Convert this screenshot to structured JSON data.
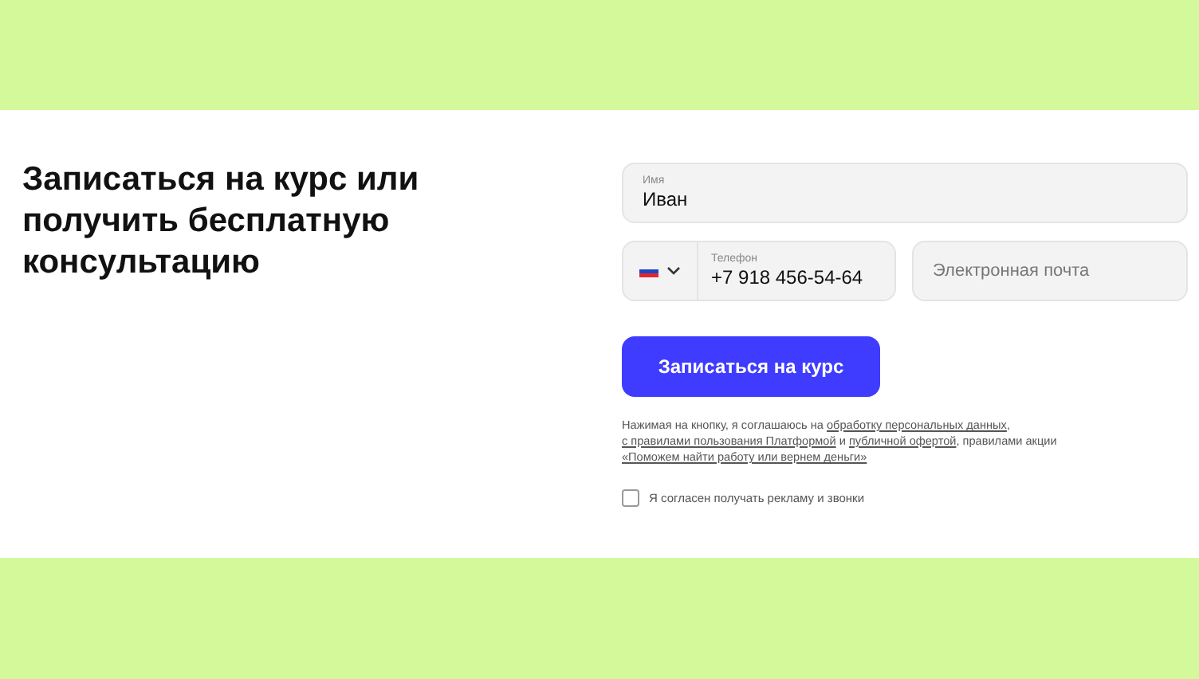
{
  "heading": "Записаться на курс или получить бесплатную консультацию",
  "name_field": {
    "label": "Имя",
    "value": "Иван"
  },
  "phone_field": {
    "label": "Телефон",
    "value": "+7 918 456-54-64"
  },
  "email_field": {
    "placeholder": "Электронная почта"
  },
  "submit_button": "Записаться на курс",
  "consent_text": [
    {
      "kind": "text",
      "text": "Нажимая на кнопку, я соглашаюсь на "
    },
    {
      "kind": "link",
      "text": "обработку персональных данных"
    },
    {
      "kind": "text",
      "text": ",  "
    },
    {
      "kind": "link",
      "text": "с правилами пользования Платформой"
    },
    {
      "kind": "text",
      "text": " и "
    },
    {
      "kind": "link",
      "text": "публичной офертой"
    },
    {
      "kind": "text",
      "text": ", правилами акции "
    },
    {
      "kind": "link",
      "text": "«Поможем найти работу или вернем деньги»"
    }
  ],
  "ads_checkbox": {
    "label": "Я согласен получать рекламу и звонки",
    "checked": false
  }
}
